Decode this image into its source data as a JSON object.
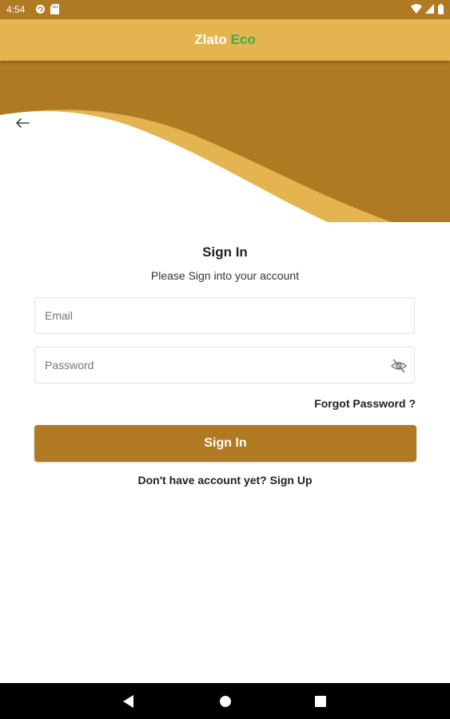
{
  "status_bar": {
    "time": "4:54",
    "left_icons": [
      "sync-circle-icon",
      "sd-card-icon"
    ],
    "right_icons": [
      "wifi-icon",
      "signal-icon",
      "battery-icon"
    ]
  },
  "app_bar": {
    "title_main": "Zlato",
    "title_accent": "Eco",
    "accent_color": "#3cb043",
    "background": "#e3b44f"
  },
  "header": {
    "back_icon": "arrow-left-icon",
    "wave_colors": [
      "#b07a22",
      "#e3b44f"
    ]
  },
  "form": {
    "title": "Sign In",
    "subtitle": "Please Sign into your account",
    "email": {
      "value": "",
      "placeholder": "Email"
    },
    "password": {
      "value": "",
      "placeholder": "Password",
      "toggle_icon": "eye-off-icon"
    },
    "forgot_label": "Forgot Password ?",
    "submit_label": "Sign In",
    "signup_prompt": "Don't have account yet?",
    "signup_link": "Sign Up"
  },
  "nav_bar": {
    "icons": [
      "back-triangle-icon",
      "home-circle-icon",
      "recents-square-icon"
    ]
  },
  "colors": {
    "primary": "#b07a22",
    "secondary": "#e3b44f",
    "text": "#222222"
  }
}
